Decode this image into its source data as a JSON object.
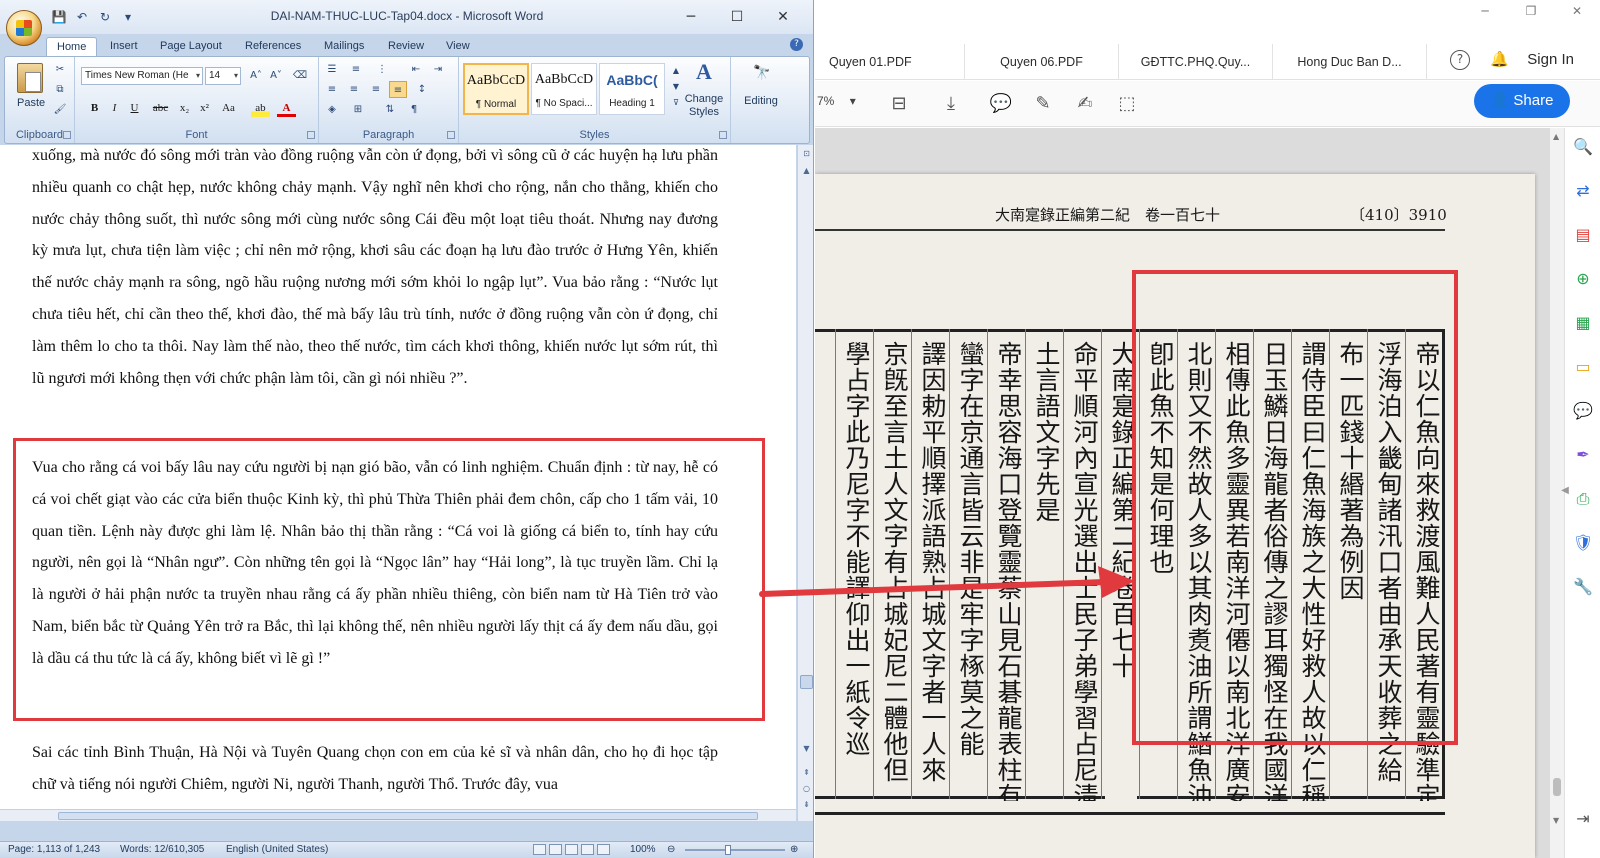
{
  "word": {
    "title": "DAI-NAM-THUC-LUC-Tap04.docx - Microsoft Word",
    "tabs": [
      "Home",
      "Insert",
      "Page Layout",
      "References",
      "Mailings",
      "Review",
      "View"
    ],
    "ribbon": {
      "clipboard": {
        "paste_label": "Paste",
        "group_label": "Clipboard"
      },
      "font": {
        "font_name": "Times New Roman (He",
        "font_size": "14",
        "group_label": "Font"
      },
      "paragraph": {
        "group_label": "Paragraph"
      },
      "styles": {
        "group_label": "Styles",
        "items": [
          {
            "sample": "AaBbCcD",
            "name": "¶ Normal"
          },
          {
            "sample": "AaBbCcD",
            "name": "¶ No Spaci..."
          },
          {
            "sample": "AaBbC(",
            "name": "Heading 1"
          }
        ],
        "change_styles_label": "Change Styles"
      },
      "editing": {
        "label": "Editing"
      }
    },
    "document": {
      "para1": "xuống, mà nước đó sông mới tràn vào đồng ruộng vẫn còn ứ đọng, bởi vì sông cũ ở các huyện hạ lưu phần nhiều quanh co chật hẹp, nước không chảy mạnh. Vậy nghĩ nên khơi cho rộng, nắn cho thẳng, khiến cho nước chảy thông suốt, thì nước sông mới cùng nước sông Cái đều một loạt tiêu thoát. Nhưng nay đương kỳ mưa lụt, chưa tiện làm việc ; chỉ nên mở rộng, khơi sâu các đoạn hạ lưu đào trước ở Hưng Yên, khiến thế nước chảy mạnh ra sông, ngõ hầu ruộng nương mới sớm khỏi lo ngập lụt”. Vua bảo rằng : “Nước lụt chưa tiêu hết, chỉ cần theo thế, khơi đào, thế mà bấy lâu trù tính, nước ở đồng ruộng vẫn còn ứ đọng, chỉ làm thêm lo cho ta thôi. Nay làm thế nào, theo thế nước, tìm cách khơi thông, khiến nước lụt sớm rút, thì lũ ngươi mới không thẹn với chức phận làm tôi, cần gì nói nhiều ?”.",
      "para2": "Vua cho rằng cá voi bấy lâu nay cứu người bị nạn gió bão, vẫn có linh nghiệm. Chuẩn định : từ nay, hễ có cá voi chết giạt vào các cửa biển thuộc Kinh kỳ, thì phủ Thừa Thiên phải đem chôn, cấp cho 1 tấm vải, 10 quan tiền. Lệnh này được ghi làm lệ. Nhân bảo thị thần rằng : “Cá voi là giống cá biển to, tính hay cứu người, nên gọi là “Nhân ngư”. Còn những tên gọi là “Ngọc lân” hay “Hải long”, là tục truyền lầm. Chỉ lạ là người ở hải phận nước ta truyền nhau rằng cá ấy phần nhiều thiêng, còn biển nam từ Hà Tiên trở vào Nam, biển bắc từ Quảng Yên trở ra Bắc, thì lại không thế, nên nhiều người lấy thịt cá ấy đem nấu dầu, gọi là dầu cá thu tức là cá ấy, không biết vì lẽ gì !”",
      "para3": "Sai các tỉnh Bình Thuận, Hà Nội và Tuyên Quang chọn con em của kẻ sĩ và nhân dân, cho họ đi học tập chữ và tiếng nói người Chiêm, người Ni, người Thanh, người Thổ. Trước đây, vua"
    },
    "status": {
      "page": "Page: 1,113 of 1,243",
      "words": "Words: 12/610,305",
      "language": "English (United States)",
      "zoom": "100%"
    }
  },
  "pdf": {
    "tabs": [
      "Quyen 01.PDF",
      "Quyen 06.PDF",
      "GĐTTC.PHQ.Quy...",
      "Hong Duc Ban D..."
    ],
    "sign_in": "Sign In",
    "share": "Share",
    "zoom": "7%",
    "page": {
      "header": "大南寔錄正編第二紀　卷一百七十",
      "page_number": "〔410〕3910",
      "columns": [
        "帝以仁魚向來救渡風難人民著有靈驗準定嗣有",
        "浮海泊入畿甸諸汛口者由承天收葬之給",
        "布一匹錢十緡著為例因",
        "謂侍臣曰仁魚海族之大性好救人故以仁稱其名",
        "日玉鱗日海龍者俗傳之謬耳獨怪在我國洋分",
        "相傳此魚多靈異若南洋河僊以南北洋廣安以",
        "北則又不然故人多以其肉煑油所謂鰌魚油者",
        "卽此魚不知是何理也",
        "大南寔錄正編第二紀卷百七十",
        "命平順河內宣光選出士民子弟學習占尼淸",
        "土言語文字先是",
        "帝幸思容海口登覽靈蔡山見石碁龍表柱有鐫刻",
        "蠻字在京通言皆云非是牢字椓莫之能",
        "譯因勅平順擇派語熟占城文字者一人來",
        "京旣至言土人文字有占城妃尼二體他但",
        "學占字此乃尼字不能譯仰出一紙令巡"
      ]
    }
  }
}
